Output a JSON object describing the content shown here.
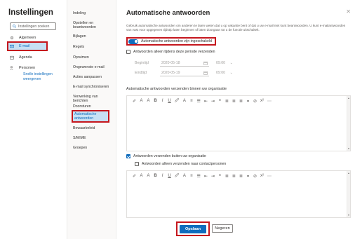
{
  "left_nav": {
    "title": "Instellingen",
    "search_placeholder": "Instellingen zoeken",
    "items": [
      {
        "label": "Algemeen",
        "icon": "gear-icon"
      },
      {
        "label": "E-mail",
        "icon": "mail-icon"
      },
      {
        "label": "Agenda",
        "icon": "calendar-icon"
      },
      {
        "label": "Personen",
        "icon": "people-icon"
      }
    ],
    "quick_settings_link": "Snelle instellingen weergeven"
  },
  "sub_nav": {
    "items": [
      "Indeling",
      "Opstellen en beantwoorden",
      "Bijlagen",
      "Regels",
      "Opruimen",
      "Ongewenste e-mail",
      "Acties aanpassen",
      "E-mail synchroniseren",
      "Verwerking van berichten",
      "Doorsturen",
      "Automatische antwoorden",
      "Bewaarbeleid",
      "S/MIME",
      "Groepen"
    ],
    "active_index": 10
  },
  "main": {
    "title": "Automatische antwoorden",
    "description": "Gebruik automatische antwoorden om anderen te laten weten dat u op vakantie bent of dat u uw e-mail niet kunt beantwoorden. U kunt e-mailantwoorden van vast voor opgegeven tijdstip laten beginnen of laten doorgaan tot u de functie uitschakelt.",
    "toggle_label": "Automatische antwoorden zijn ingeschakeld",
    "period_checkbox": "Antwoorden alleen tijdens deze periode verzenden",
    "start_label": "Begintijd",
    "start_date": "2020-05-18",
    "start_time": "09:00",
    "end_label": "Eindtijd",
    "end_date": "2020-05-19",
    "end_time": "09:00",
    "inside_label": "Automatische antwoorden verzenden binnen uw organisatie",
    "outside_checkbox": "Antwoorden verzenden buiten uw organisatie",
    "contacts_checkbox": "Antwoorden alleen verzenden naar contactpersonen",
    "toolbar_glyphs": [
      "✐",
      "A",
      "A",
      "B",
      "I",
      "U",
      "🖉",
      "A",
      "≡",
      "☰",
      "⇤",
      "⇥",
      "❝",
      "≣",
      "≣",
      "≣",
      "⚭",
      "⊘",
      "x²",
      "⋯"
    ],
    "save_label": "Opslaan",
    "cancel_label": "Negeren",
    "accent": "#0f6cbd",
    "highlight_border": "#c5161d"
  }
}
